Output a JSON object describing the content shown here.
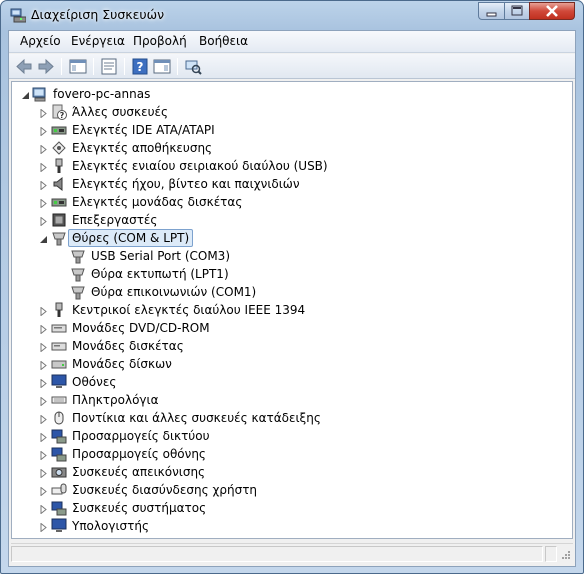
{
  "window": {
    "title": "Διαχείριση Συσκευών",
    "icon": "device-manager-icon"
  },
  "menu": {
    "items": [
      "Αρχείο",
      "Ενέργεια",
      "Προβολή",
      "Βοήθεια"
    ]
  },
  "toolbar": {
    "buttons": [
      "back-arrow-icon",
      "forward-arrow-icon",
      "show-hide-console-tree-icon",
      "properties-icon",
      "help-icon",
      "show-action-pane-icon",
      "scan-hardware-icon"
    ]
  },
  "tree": {
    "root": {
      "label": "fovero-pc-annas",
      "icon": "computer-icon",
      "expanded": true
    },
    "categories": [
      {
        "label": "Άλλες συσκευές",
        "icon": "unknown-device-icon",
        "expanded": false
      },
      {
        "label": "Ελεγκτές IDE ATA/ATAPI",
        "icon": "ide-controller-icon",
        "expanded": false
      },
      {
        "label": "Ελεγκτές αποθήκευσης",
        "icon": "storage-controller-icon",
        "expanded": false
      },
      {
        "label": "Ελεγκτές ενιαίου σειριακού διαύλου (USB)",
        "icon": "usb-controller-icon",
        "expanded": false
      },
      {
        "label": "Ελεγκτές ήχου, βίντεο και παιχνιδιών",
        "icon": "speaker-icon",
        "expanded": false
      },
      {
        "label": "Ελεγκτές μονάδας δισκέτας",
        "icon": "floppy-controller-icon",
        "expanded": false
      },
      {
        "label": "Επεξεργαστές",
        "icon": "processor-icon",
        "expanded": false
      },
      {
        "label": "Θύρες (COM & LPT)",
        "icon": "port-icon",
        "expanded": true,
        "selected": true,
        "children": [
          {
            "label": "USB Serial Port (COM3)",
            "icon": "port-icon"
          },
          {
            "label": "Θύρα εκτυπωτή (LPT1)",
            "icon": "port-icon"
          },
          {
            "label": "Θύρα επικοινωνιών (COM1)",
            "icon": "port-icon"
          }
        ]
      },
      {
        "label": "Κεντρικοί ελεγκτές διαύλου IEEE 1394",
        "icon": "ieee1394-icon",
        "expanded": false
      },
      {
        "label": "Μονάδες DVD/CD-ROM",
        "icon": "dvd-drive-icon",
        "expanded": false
      },
      {
        "label": "Μονάδες δισκέτας",
        "icon": "floppy-drive-icon",
        "expanded": false
      },
      {
        "label": "Μονάδες δίσκων",
        "icon": "disk-drive-icon",
        "expanded": false
      },
      {
        "label": "Οθόνες",
        "icon": "monitor-icon",
        "expanded": false
      },
      {
        "label": "Πληκτρολόγια",
        "icon": "keyboard-icon",
        "expanded": false
      },
      {
        "label": "Ποντίκια και άλλες συσκευές κατάδειξης",
        "icon": "mouse-icon",
        "expanded": false
      },
      {
        "label": "Προσαρμογείς δικτύου",
        "icon": "network-adapter-icon",
        "expanded": false
      },
      {
        "label": "Προσαρμογείς οθόνης",
        "icon": "display-adapter-icon",
        "expanded": false
      },
      {
        "label": "Συσκευές απεικόνισης",
        "icon": "camera-icon",
        "expanded": false
      },
      {
        "label": "Συσκευές διασύνδεσης χρήστη",
        "icon": "hid-icon",
        "expanded": false
      },
      {
        "label": "Συσκευές συστήματος",
        "icon": "system-device-icon",
        "expanded": false
      },
      {
        "label": "Υπολογιστής",
        "icon": "computer-monitor-icon",
        "expanded": false
      }
    ]
  },
  "colors": {
    "selection_bg": "#dceaf8",
    "selection_border": "#7da2ce",
    "close_button": "#c7402f"
  }
}
